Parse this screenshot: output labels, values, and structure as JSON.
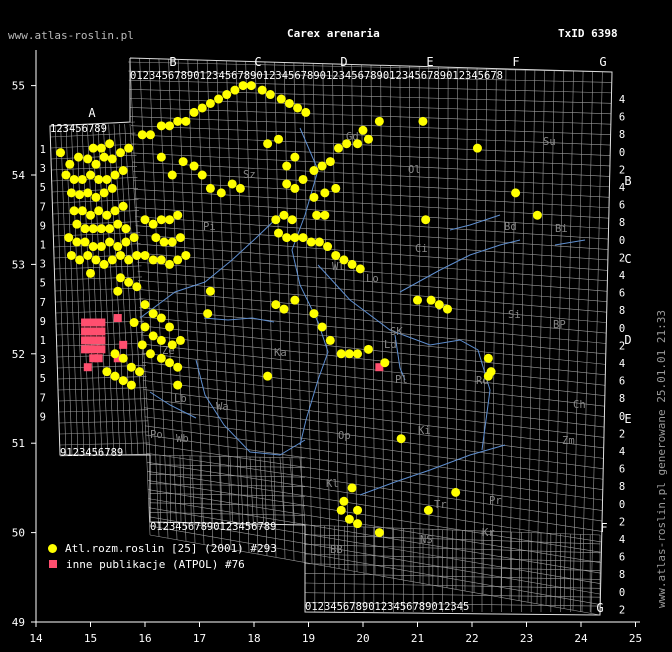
{
  "header": {
    "site": "www.atlas-roslin.pl",
    "title": "Carex arenaria",
    "taxid": "TxID 6398"
  },
  "side_note": "www.atlas-roslin.pl generowane 25.01.01 21:33",
  "legend": [
    {
      "symbol": "circle",
      "color": "#ffff00",
      "label": "Atl.rozm.roslin [25] (2001) #293"
    },
    {
      "symbol": "square",
      "color": "#ff4f6f",
      "label": "inne publikacje (ATPOL) #76"
    }
  ],
  "axes": {
    "lon_ticks": [
      "14",
      "15",
      "16",
      "17",
      "18",
      "19",
      "20",
      "21",
      "22",
      "23",
      "24",
      "25"
    ],
    "lat_ticks": [
      "49",
      "50",
      "51",
      "52",
      "53",
      "54",
      "55"
    ]
  },
  "atpol": {
    "top_letters": [
      "B",
      "C",
      "D",
      "E",
      "F",
      "G"
    ],
    "left_letter": "A",
    "right_letters": [
      "B",
      "C",
      "D",
      "E"
    ],
    "bottom_right_letters": [
      "F",
      "G"
    ],
    "digits_top": "0123456789",
    "digits_top_G": "012345678",
    "digits_A_top": "123456789",
    "digits_bottom_left": "0123456789",
    "digits_bottom": "0123456789",
    "digits_bottom_last": "012345",
    "digits_A_left": [
      "1",
      "3",
      "5",
      "7",
      "9",
      "1",
      "3",
      "5",
      "7",
      "9",
      "1",
      "3",
      "5",
      "7",
      "9"
    ],
    "digits_A_bottom": "9123456789",
    "digits_right": [
      "4",
      "6",
      "8",
      "0",
      "2",
      "4",
      "6",
      "8",
      "0",
      "2",
      "4",
      "6",
      "8",
      "0",
      "2",
      "4",
      "6",
      "8",
      "0",
      "2",
      "4",
      "6",
      "8",
      "0",
      "2",
      "4",
      "6",
      "8",
      "0",
      "2"
    ]
  },
  "regions": [
    "Sz",
    "Gd",
    "Ol",
    "Su",
    "Bi",
    "Pi",
    "Ci",
    "Os",
    "Bd",
    "Wl",
    "Lo",
    "SK",
    "Ld",
    "Si",
    "BP",
    "Pl",
    "Rd",
    "Lb",
    "Ch",
    "Zm",
    "Ze",
    "Wa",
    "Po",
    "Op",
    "Wb",
    "Ka",
    "Kl",
    "Ki",
    "Tr",
    "Pr",
    "BB",
    "NS",
    "Kr"
  ],
  "colors": {
    "background": "#000000",
    "grid": "#9c9c9c",
    "axis": "#ffffff",
    "rivers": "#5f8fd0",
    "regions_text": "#888888",
    "record_atlas": "#ffff00",
    "record_other": "#ff4f6f"
  },
  "records": {
    "atlas_lonlat": [
      [
        14.45,
        54.25
      ],
      [
        14.62,
        54.12
      ],
      [
        14.78,
        54.2
      ],
      [
        14.95,
        54.18
      ],
      [
        15.1,
        54.12
      ],
      [
        15.25,
        54.2
      ],
      [
        15.4,
        54.18
      ],
      [
        15.55,
        54.25
      ],
      [
        15.7,
        54.3
      ],
      [
        15.05,
        54.3
      ],
      [
        15.2,
        54.3
      ],
      [
        15.35,
        54.35
      ],
      [
        14.55,
        54.0
      ],
      [
        14.7,
        53.95
      ],
      [
        14.85,
        53.95
      ],
      [
        15.0,
        54.0
      ],
      [
        15.15,
        53.95
      ],
      [
        15.3,
        53.95
      ],
      [
        15.45,
        54.0
      ],
      [
        15.6,
        54.05
      ],
      [
        14.65,
        53.8
      ],
      [
        14.8,
        53.78
      ],
      [
        14.95,
        53.8
      ],
      [
        15.1,
        53.75
      ],
      [
        15.25,
        53.8
      ],
      [
        15.4,
        53.85
      ],
      [
        14.7,
        53.6
      ],
      [
        14.85,
        53.6
      ],
      [
        15.0,
        53.55
      ],
      [
        15.15,
        53.6
      ],
      [
        15.3,
        53.55
      ],
      [
        15.45,
        53.6
      ],
      [
        15.6,
        53.65
      ],
      [
        14.75,
        53.45
      ],
      [
        14.9,
        53.4
      ],
      [
        15.05,
        53.4
      ],
      [
        15.2,
        53.4
      ],
      [
        15.35,
        53.4
      ],
      [
        15.5,
        53.45
      ],
      [
        15.65,
        53.4
      ],
      [
        14.6,
        53.3
      ],
      [
        14.75,
        53.25
      ],
      [
        14.9,
        53.25
      ],
      [
        15.05,
        53.2
      ],
      [
        15.2,
        53.2
      ],
      [
        15.35,
        53.25
      ],
      [
        15.5,
        53.2
      ],
      [
        15.65,
        53.25
      ],
      [
        15.8,
        53.3
      ],
      [
        14.65,
        53.1
      ],
      [
        14.8,
        53.05
      ],
      [
        14.95,
        53.1
      ],
      [
        15.1,
        53.05
      ],
      [
        15.25,
        53.0
      ],
      [
        15.4,
        53.05
      ],
      [
        15.55,
        53.1
      ],
      [
        15.7,
        53.05
      ],
      [
        15.85,
        53.1
      ],
      [
        15.0,
        52.9
      ],
      [
        15.55,
        52.85
      ],
      [
        15.7,
        52.8
      ],
      [
        15.85,
        52.75
      ],
      [
        15.5,
        52.7
      ],
      [
        16.0,
        53.5
      ],
      [
        16.15,
        53.45
      ],
      [
        16.3,
        53.5
      ],
      [
        16.45,
        53.5
      ],
      [
        16.6,
        53.55
      ],
      [
        16.2,
        53.3
      ],
      [
        16.35,
        53.25
      ],
      [
        16.5,
        53.25
      ],
      [
        16.65,
        53.3
      ],
      [
        16.0,
        53.1
      ],
      [
        16.15,
        53.05
      ],
      [
        16.3,
        53.05
      ],
      [
        16.45,
        53.0
      ],
      [
        16.6,
        53.05
      ],
      [
        16.75,
        53.1
      ],
      [
        15.95,
        54.45
      ],
      [
        16.1,
        54.45
      ],
      [
        16.3,
        54.55
      ],
      [
        16.45,
        54.55
      ],
      [
        16.6,
        54.6
      ],
      [
        16.75,
        54.6
      ],
      [
        16.9,
        54.7
      ],
      [
        17.05,
        54.75
      ],
      [
        17.2,
        54.8
      ],
      [
        17.35,
        54.85
      ],
      [
        17.5,
        54.9
      ],
      [
        17.65,
        54.95
      ],
      [
        17.8,
        55.0
      ],
      [
        17.95,
        55.0
      ],
      [
        18.15,
        54.95
      ],
      [
        18.3,
        54.9
      ],
      [
        18.5,
        54.85
      ],
      [
        18.65,
        54.8
      ],
      [
        18.8,
        54.75
      ],
      [
        18.95,
        54.7
      ],
      [
        16.3,
        54.2
      ],
      [
        16.5,
        54.0
      ],
      [
        16.7,
        54.15
      ],
      [
        16.9,
        54.1
      ],
      [
        17.05,
        54.0
      ],
      [
        17.2,
        53.85
      ],
      [
        17.4,
        53.8
      ],
      [
        17.6,
        53.9
      ],
      [
        17.75,
        53.85
      ],
      [
        18.25,
        54.35
      ],
      [
        18.45,
        54.4
      ],
      [
        18.6,
        54.1
      ],
      [
        18.75,
        54.2
      ],
      [
        18.6,
        53.9
      ],
      [
        18.75,
        53.85
      ],
      [
        18.9,
        53.95
      ],
      [
        19.1,
        54.05
      ],
      [
        19.25,
        54.1
      ],
      [
        19.4,
        54.15
      ],
      [
        19.55,
        54.3
      ],
      [
        19.7,
        54.35
      ],
      [
        19.9,
        54.35
      ],
      [
        20.1,
        54.4
      ],
      [
        19.1,
        53.75
      ],
      [
        19.3,
        53.8
      ],
      [
        19.5,
        53.85
      ],
      [
        19.15,
        53.55
      ],
      [
        19.3,
        53.55
      ],
      [
        18.4,
        53.5
      ],
      [
        18.55,
        53.55
      ],
      [
        18.7,
        53.5
      ],
      [
        18.45,
        53.35
      ],
      [
        18.6,
        53.3
      ],
      [
        18.75,
        53.3
      ],
      [
        18.9,
        53.3
      ],
      [
        19.05,
        53.25
      ],
      [
        19.2,
        53.25
      ],
      [
        19.35,
        53.2
      ],
      [
        19.5,
        53.1
      ],
      [
        19.65,
        53.05
      ],
      [
        19.8,
        53.0
      ],
      [
        19.95,
        52.95
      ],
      [
        18.4,
        52.55
      ],
      [
        18.55,
        52.5
      ],
      [
        18.75,
        52.6
      ],
      [
        19.1,
        52.45
      ],
      [
        19.25,
        52.3
      ],
      [
        19.4,
        52.15
      ],
      [
        19.6,
        52.0
      ],
      [
        19.75,
        52.0
      ],
      [
        19.9,
        52.0
      ],
      [
        20.1,
        52.05
      ],
      [
        20.4,
        51.9
      ],
      [
        21.0,
        52.6
      ],
      [
        21.25,
        52.6
      ],
      [
        21.4,
        52.55
      ],
      [
        21.55,
        52.5
      ],
      [
        22.3,
        51.95
      ],
      [
        22.35,
        51.8
      ],
      [
        22.3,
        51.75
      ],
      [
        22.8,
        53.8
      ],
      [
        23.2,
        53.55
      ],
      [
        22.1,
        54.3
      ],
      [
        21.1,
        54.6
      ],
      [
        21.15,
        53.5
      ],
      [
        16.0,
        52.55
      ],
      [
        16.15,
        52.45
      ],
      [
        16.3,
        52.4
      ],
      [
        16.45,
        52.3
      ],
      [
        16.0,
        52.3
      ],
      [
        16.15,
        52.2
      ],
      [
        16.3,
        52.15
      ],
      [
        16.5,
        52.1
      ],
      [
        16.65,
        52.15
      ],
      [
        15.8,
        52.35
      ],
      [
        15.95,
        52.1
      ],
      [
        16.1,
        52.0
      ],
      [
        16.3,
        51.95
      ],
      [
        16.45,
        51.9
      ],
      [
        16.6,
        51.85
      ],
      [
        15.45,
        52.0
      ],
      [
        15.6,
        51.95
      ],
      [
        15.75,
        51.85
      ],
      [
        15.9,
        51.8
      ],
      [
        15.3,
        51.8
      ],
      [
        15.45,
        51.75
      ],
      [
        15.6,
        51.7
      ],
      [
        15.75,
        51.65
      ],
      [
        16.6,
        51.65
      ],
      [
        17.15,
        52.45
      ],
      [
        17.2,
        52.7
      ],
      [
        18.25,
        51.75
      ],
      [
        19.65,
        50.35
      ],
      [
        19.9,
        50.25
      ],
      [
        19.6,
        50.25
      ],
      [
        19.75,
        50.15
      ],
      [
        19.9,
        50.1
      ],
      [
        20.3,
        50.0
      ],
      [
        21.2,
        50.25
      ],
      [
        21.7,
        50.45
      ],
      [
        20.7,
        51.05
      ],
      [
        19.8,
        50.5
      ],
      [
        20.0,
        54.5
      ],
      [
        20.3,
        54.6
      ]
    ],
    "other_lonlat": [
      [
        14.9,
        52.35
      ],
      [
        15.0,
        52.35
      ],
      [
        15.1,
        52.35
      ],
      [
        15.2,
        52.35
      ],
      [
        14.9,
        52.25
      ],
      [
        15.0,
        52.25
      ],
      [
        15.1,
        52.25
      ],
      [
        15.2,
        52.25
      ],
      [
        14.9,
        52.15
      ],
      [
        15.0,
        52.15
      ],
      [
        15.1,
        52.15
      ],
      [
        15.2,
        52.15
      ],
      [
        14.9,
        52.05
      ],
      [
        15.0,
        52.05
      ],
      [
        15.1,
        52.05
      ],
      [
        15.2,
        52.05
      ],
      [
        15.05,
        51.95
      ],
      [
        15.15,
        51.95
      ],
      [
        14.95,
        51.85
      ],
      [
        15.5,
        51.95
      ],
      [
        15.6,
        52.1
      ],
      [
        15.5,
        52.4
      ],
      [
        20.3,
        51.85
      ]
    ]
  }
}
